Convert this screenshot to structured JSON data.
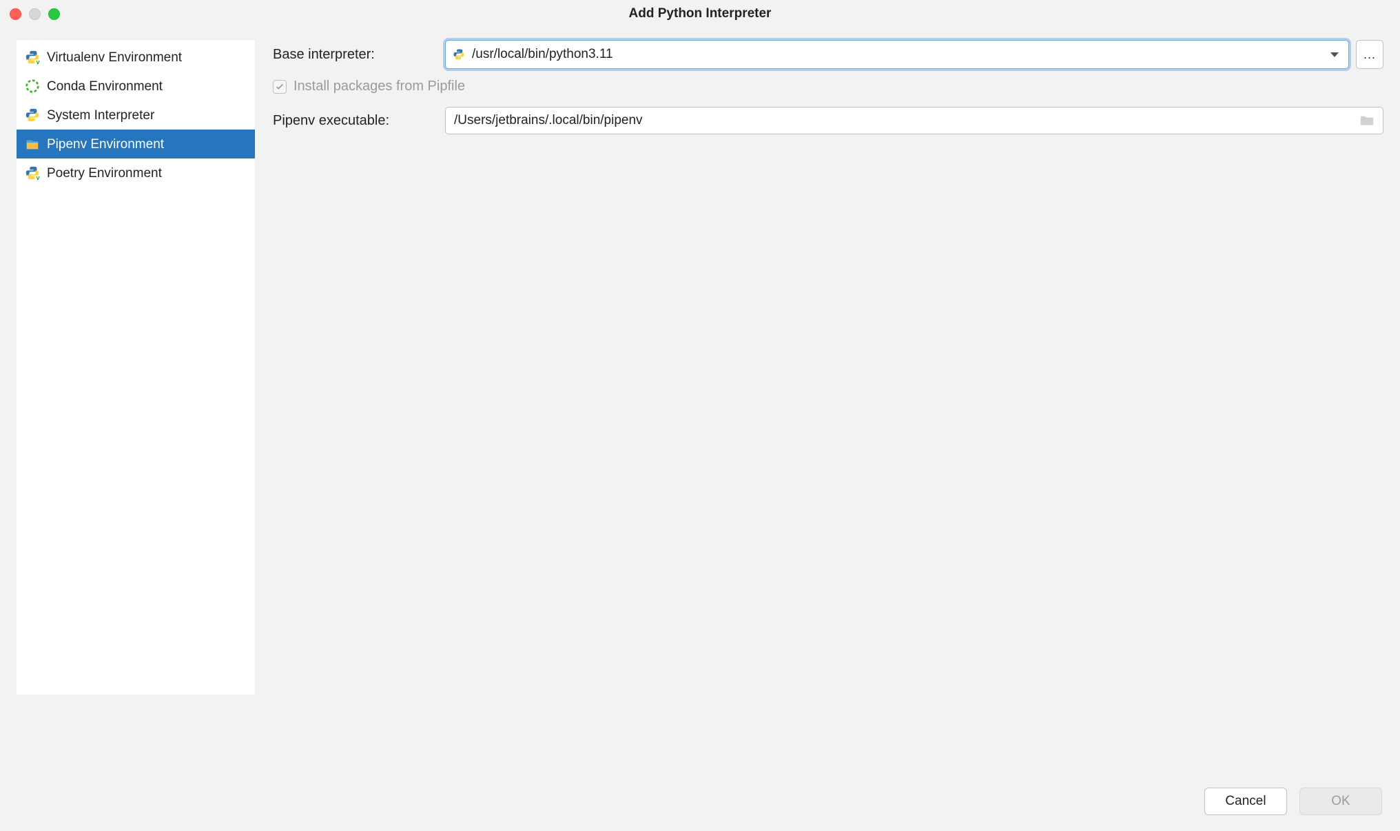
{
  "window": {
    "title": "Add Python Interpreter"
  },
  "sidebar": {
    "items": [
      {
        "label": "Virtualenv Environment",
        "icon": "python-v"
      },
      {
        "label": "Conda Environment",
        "icon": "conda"
      },
      {
        "label": "System Interpreter",
        "icon": "python"
      },
      {
        "label": "Pipenv Environment",
        "icon": "pipenv",
        "selected": true
      },
      {
        "label": "Poetry Environment",
        "icon": "python-v"
      }
    ]
  },
  "form": {
    "baseInterpreter": {
      "label": "Base interpreter:",
      "value": "/usr/local/bin/python3.11"
    },
    "installPackages": {
      "label": "Install packages from Pipfile",
      "checked": true,
      "disabled": true
    },
    "pipenvExecutable": {
      "label": "Pipenv executable:",
      "value": "/Users/jetbrains/.local/bin/pipenv"
    }
  },
  "buttons": {
    "cancel": "Cancel",
    "ok": "OK"
  },
  "browseGlyph": "..."
}
